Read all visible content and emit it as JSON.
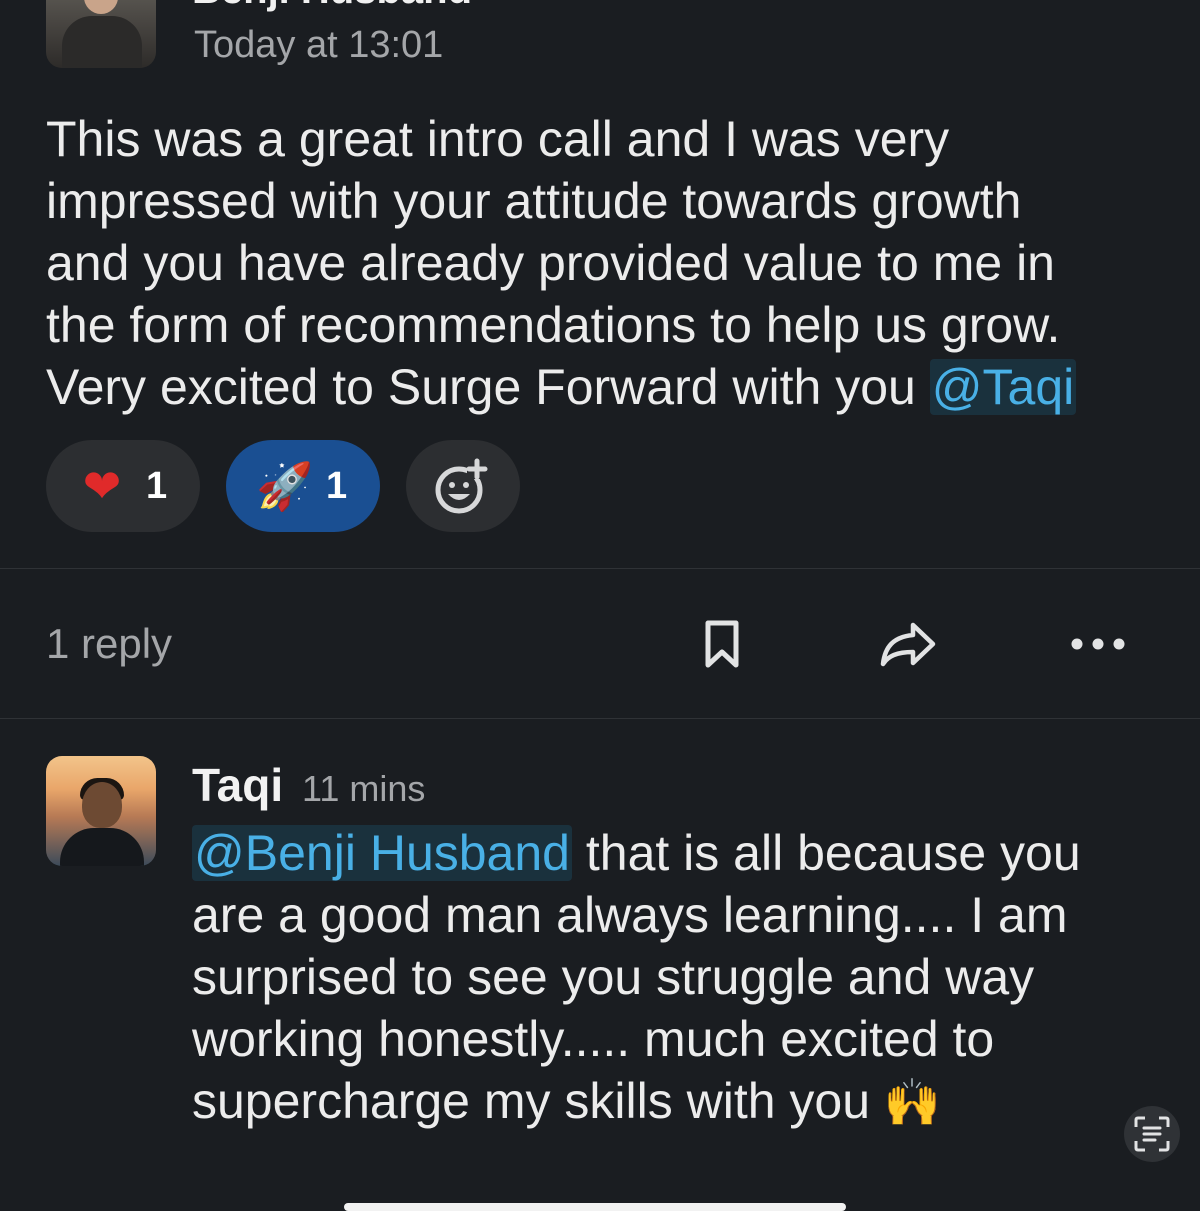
{
  "top_message": {
    "author": "Benji Husband",
    "timestamp": "Today at 13:01",
    "text_before_mention": "This was a great intro call and I was very\nimpressed with your attitude towards growth\nand you have already provided value to me in\nthe form of recommendations to help us grow.\nVery excited to Surge Forward with you ",
    "mention": "@Taqi",
    "reactions": [
      {
        "emoji": "❤",
        "count": "1",
        "active": false
      },
      {
        "emoji": "🚀",
        "count": "1",
        "active": true
      }
    ],
    "add_reaction_icon": "add-reaction-icon"
  },
  "thread_bar": {
    "reply_count": "1 reply",
    "icons": [
      "bookmark-icon",
      "share-icon",
      "more-icon"
    ]
  },
  "reply": {
    "author": "Taqi",
    "time": "11 mins",
    "mention": "@Benji Husband",
    "text": " that is all because you are a good man always learning.... I am surprised to see you struggle and way working honestly..... much excited to supercharge my skills with you ",
    "emoji": "🙌"
  },
  "colors": {
    "background": "#1a1d21",
    "mention": "#49b0e6",
    "active_reaction": "#1a4f92"
  }
}
